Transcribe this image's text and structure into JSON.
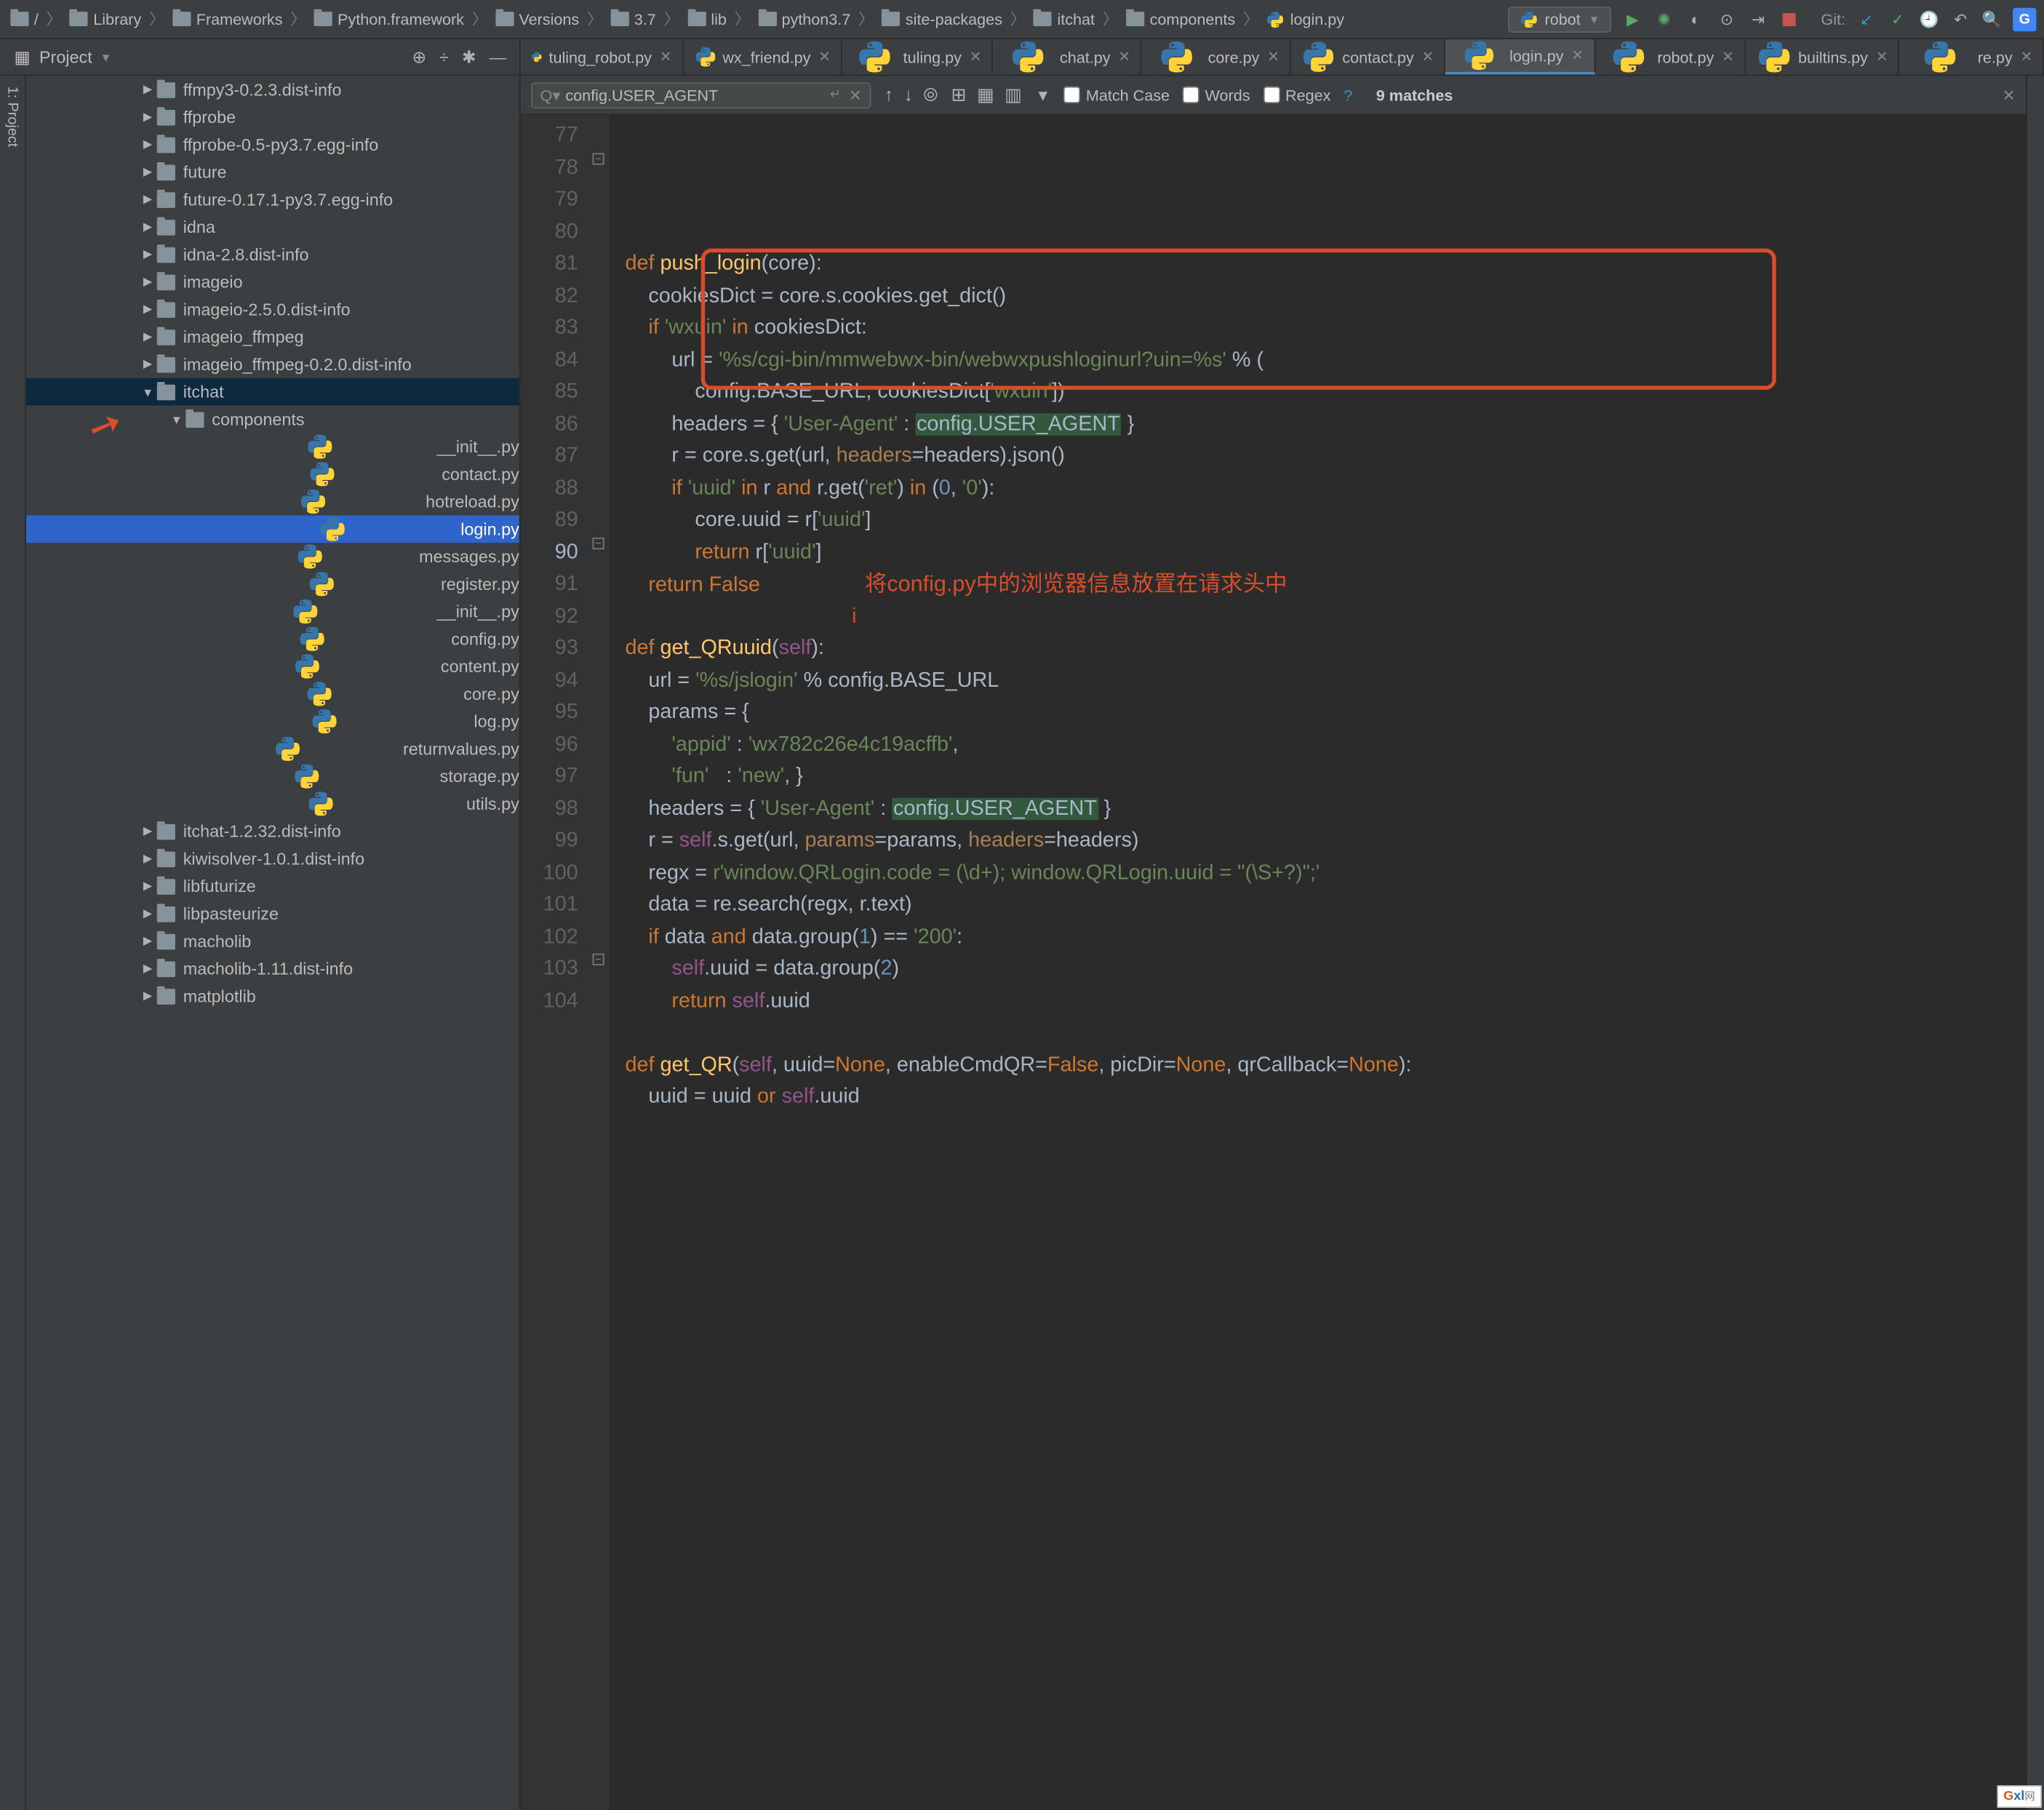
{
  "breadcrumb": [
    "Library",
    "Frameworks",
    "Python.framework",
    "Versions",
    "3.7",
    "lib",
    "python3.7",
    "site-packages",
    "itchat",
    "components",
    "login.py"
  ],
  "run_config": "robot",
  "git_label": "Git:",
  "project_header": "Project",
  "tabs": [
    {
      "label": "tuling_robot.py",
      "active": false
    },
    {
      "label": "wx_friend.py",
      "active": false
    },
    {
      "label": "tuling.py",
      "active": false
    },
    {
      "label": "chat.py",
      "active": false
    },
    {
      "label": "core.py",
      "active": false
    },
    {
      "label": "contact.py",
      "active": false
    },
    {
      "label": "login.py",
      "active": true
    },
    {
      "label": "robot.py",
      "active": false
    },
    {
      "label": "builtins.py",
      "active": false
    },
    {
      "label": "re.py",
      "active": false
    }
  ],
  "find": {
    "query": "config.USER_AGENT",
    "match_case": "Match Case",
    "words": "Words",
    "regex": "Regex",
    "matches": "9 matches"
  },
  "tree": [
    {
      "indent": 4,
      "arrow": "▶",
      "type": "folder",
      "label": "ffmpy3-0.2.3.dist-info"
    },
    {
      "indent": 4,
      "arrow": "▶",
      "type": "folder",
      "label": "ffprobe"
    },
    {
      "indent": 4,
      "arrow": "▶",
      "type": "folder",
      "label": "ffprobe-0.5-py3.7.egg-info"
    },
    {
      "indent": 4,
      "arrow": "▶",
      "type": "folder",
      "label": "future"
    },
    {
      "indent": 4,
      "arrow": "▶",
      "type": "folder",
      "label": "future-0.17.1-py3.7.egg-info"
    },
    {
      "indent": 4,
      "arrow": "▶",
      "type": "folder",
      "label": "idna"
    },
    {
      "indent": 4,
      "arrow": "▶",
      "type": "folder",
      "label": "idna-2.8.dist-info"
    },
    {
      "indent": 4,
      "arrow": "▶",
      "type": "folder",
      "label": "imageio"
    },
    {
      "indent": 4,
      "arrow": "▶",
      "type": "folder",
      "label": "imageio-2.5.0.dist-info"
    },
    {
      "indent": 4,
      "arrow": "▶",
      "type": "folder",
      "label": "imageio_ffmpeg"
    },
    {
      "indent": 4,
      "arrow": "▶",
      "type": "folder",
      "label": "imageio_ffmpeg-0.2.0.dist-info"
    },
    {
      "indent": 4,
      "arrow": "▼",
      "type": "folder",
      "label": "itchat",
      "sel": "grey"
    },
    {
      "indent": 5,
      "arrow": "▼",
      "type": "folder",
      "label": "components"
    },
    {
      "indent": 6,
      "arrow": "",
      "type": "py",
      "label": "__init__.py"
    },
    {
      "indent": 6,
      "arrow": "",
      "type": "py",
      "label": "contact.py"
    },
    {
      "indent": 6,
      "arrow": "",
      "type": "py",
      "label": "hotreload.py"
    },
    {
      "indent": 6,
      "arrow": "",
      "type": "py",
      "label": "login.py",
      "sel": "blue"
    },
    {
      "indent": 6,
      "arrow": "",
      "type": "py",
      "label": "messages.py"
    },
    {
      "indent": 6,
      "arrow": "",
      "type": "py",
      "label": "register.py"
    },
    {
      "indent": 5,
      "arrow": "",
      "type": "py",
      "label": "__init__.py"
    },
    {
      "indent": 5,
      "arrow": "",
      "type": "py",
      "label": "config.py"
    },
    {
      "indent": 5,
      "arrow": "",
      "type": "py",
      "label": "content.py"
    },
    {
      "indent": 5,
      "arrow": "",
      "type": "py",
      "label": "core.py"
    },
    {
      "indent": 5,
      "arrow": "",
      "type": "py",
      "label": "log.py"
    },
    {
      "indent": 5,
      "arrow": "",
      "type": "py",
      "label": "returnvalues.py"
    },
    {
      "indent": 5,
      "arrow": "",
      "type": "py",
      "label": "storage.py"
    },
    {
      "indent": 5,
      "arrow": "",
      "type": "py",
      "label": "utils.py"
    },
    {
      "indent": 4,
      "arrow": "▶",
      "type": "folder",
      "label": "itchat-1.2.32.dist-info"
    },
    {
      "indent": 4,
      "arrow": "▶",
      "type": "folder",
      "label": "kiwisolver-1.0.1.dist-info"
    },
    {
      "indent": 4,
      "arrow": "▶",
      "type": "folder",
      "label": "libfuturize"
    },
    {
      "indent": 4,
      "arrow": "▶",
      "type": "folder",
      "label": "libpasteurize"
    },
    {
      "indent": 4,
      "arrow": "▶",
      "type": "folder",
      "label": "macholib"
    },
    {
      "indent": 4,
      "arrow": "▶",
      "type": "folder",
      "label": "macholib-1.11.dist-info"
    },
    {
      "indent": 4,
      "arrow": "▶",
      "type": "folder",
      "label": "matplotlib"
    }
  ],
  "gutter_start": 77,
  "gutter_end": 104,
  "gutter_hl": 90,
  "annotation": "将config.py中的浏览器信息放置在请求头中",
  "code_lines_raw": [
    "",
    "<kw>def</kw> <fn>push_login</fn>(core):",
    "    cookiesDict = core.s.cookies.get_dict()",
    "    <kw>if</kw> <str>'wxuin'</str> <kw>in</kw> cookiesDict:",
    "        url = <str>'%s/cgi-bin/mmwebwx-bin/webwxpushloginurl?uin=%s'</str> % (",
    "            config.BASE_URL, cookiesDict[<str>'wxuin'</str>])",
    "        headers = { <str>'User-Agent'</str> : <hl>config.USER_AGENT</hl> }",
    "        r = core.s.get(url, <param>headers</param>=headers).json()",
    "        <kw>if</kw> <str>'uuid'</str> <kw>in</kw> r <kw>and</kw> r.get(<str>'ret'</str>) <kw>in</kw> (<num>0</num>, <str>'0'</str>):",
    "            core.uuid = r[<str>'uuid'</str>]",
    "            <kw>return</kw> r[<str>'uuid'</str>]",
    "    <kw>return</kw> <kw>False</kw>                  <anno>",
    "                                       <cur>i</cur>",
    "<kw>def</kw> <fn>get_QRuuid</fn>(<self>self</self>):",
    "    url = <str>'%s/jslogin'</str> % config.BASE_URL",
    "    params = {",
    "        <str>'appid'</str> : <str>'wx782c26e4c19acffb'</str>,",
    "        <str>'fun'</str>   : <str>'new'</str>, }",
    "    headers = { <str>'User-Agent'</str> : <hl>config.USER_AGENT</hl> }",
    "    r = <self>self</self>.s.get(url, <param>params</param>=params, <param>headers</param>=headers)",
    "    regx = <str>r'window.QRLogin.code = (\\d+); window.QRLogin.uuid = \"(\\S+?)\";'</str>",
    "    data = re.search(regx, r.text)",
    "    <kw>if</kw> data <kw>and</kw> data.group(<num>1</num>) == <str>'200'</str>:",
    "        <self>self</self>.uuid = data.group(<num>2</num>)",
    "        <kw>return</kw> <self>self</self>.uuid",
    "",
    "<kw>def</kw> <fn>get_QR</fn>(<self>self</self>, uuid=<kw>None</kw>, enableCmdQR=<kw>False</kw>, picDir=<kw>None</kw>, qrCallback=<kw>None</kw>):",
    "    uuid = uuid <kw>or</kw> <self>self</self>.uuid"
  ],
  "watermark_text": "Gxl网"
}
